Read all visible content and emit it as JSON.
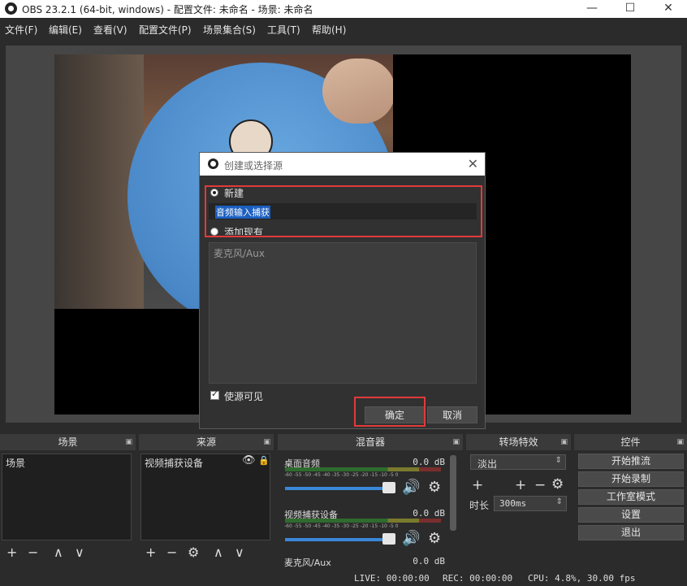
{
  "window": {
    "title": "OBS 23.2.1 (64-bit, windows) - 配置文件: 未命名 - 场景: 未命名",
    "minimize_glyph": "—",
    "maximize_glyph": "☐",
    "close_glyph": "✕"
  },
  "menu": [
    "文件(F)",
    "编辑(E)",
    "查看(V)",
    "配置文件(P)",
    "场景集合(S)",
    "工具(T)",
    "帮助(H)"
  ],
  "dialog": {
    "title": "创建或选择源",
    "close_glyph": "✕",
    "radio_new": "新建",
    "new_name_value": "音频输入捕获",
    "radio_existing": "添加现有",
    "existing_items": [
      "麦克风/Aux"
    ],
    "visible_checkbox": "使源可见",
    "ok": "确定",
    "cancel": "取消"
  },
  "docks": {
    "scenes": {
      "title": "场景",
      "items": [
        "场景"
      ]
    },
    "sources": {
      "title": "来源",
      "items": [
        "视频捕获设备"
      ]
    },
    "mixer": {
      "title": "混音器",
      "channels": [
        {
          "name": "桌面音频",
          "db": "0.0 dB"
        },
        {
          "name": "视频捕获设备",
          "db": "0.0 dB"
        },
        {
          "name": "麦克风/Aux",
          "db": "0.0 dB"
        }
      ],
      "ticks": "-60 -55 -50 -45 -40 -35 -30 -25 -20 -15 -10 -5 0"
    },
    "transitions": {
      "title": "转场特效",
      "selected": "淡出",
      "duration_label": "时长",
      "duration_value": "300ms"
    },
    "controls": {
      "title": "控件",
      "buttons": [
        "开始推流",
        "开始录制",
        "工作室模式",
        "设置",
        "退出"
      ]
    }
  },
  "icons": {
    "plus": "+",
    "minus": "−",
    "up": "∧",
    "down": "∨",
    "gear": "⚙",
    "eye": "👁",
    "lock": "🔒",
    "speaker": "🔊",
    "pin": "▣"
  },
  "status": {
    "live": "LIVE: 00:00:00",
    "rec": "REC: 00:00:00",
    "cpu": "CPU: 4.8%, 30.00 fps"
  }
}
